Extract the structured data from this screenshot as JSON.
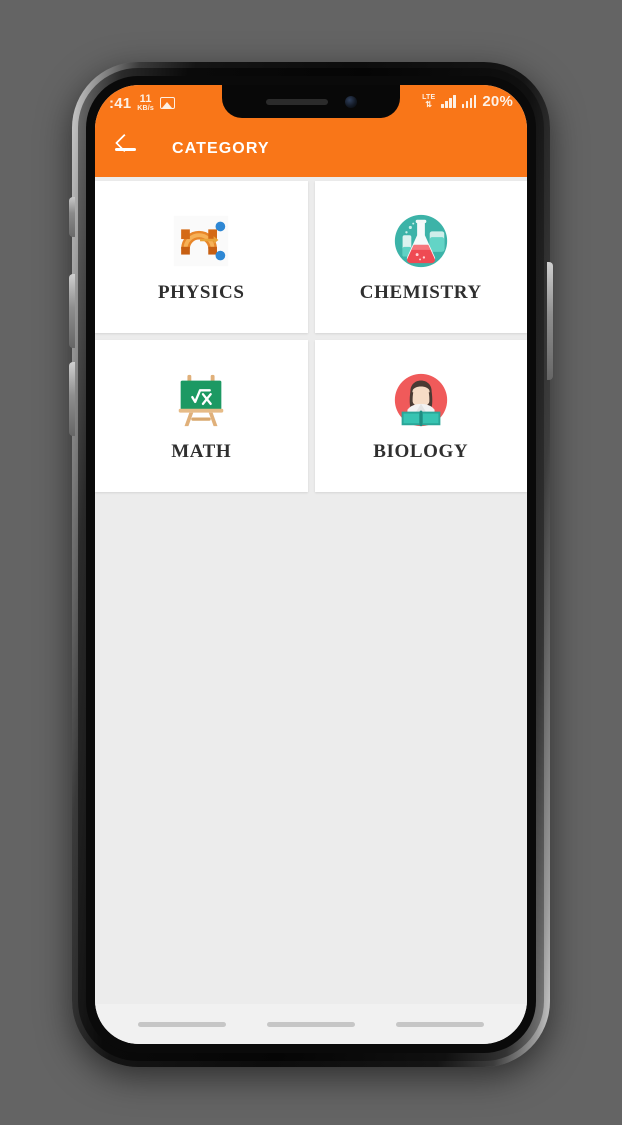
{
  "status_bar": {
    "time": ":41",
    "net_speed_value": "11",
    "net_speed_unit": "KB/s",
    "photo_icon": "image-icon",
    "network_type": "LTE",
    "data_arrows": "⇅",
    "battery": "20%"
  },
  "appbar": {
    "back_icon": "back-arrow-icon",
    "title": "CATEGORY",
    "background_color": "#f97618",
    "text_color": "#ffffff"
  },
  "categories": [
    {
      "label": "PHYSICS",
      "icon": "magnet-icon",
      "icon_color": "#f3a13a"
    },
    {
      "label": "CHEMISTRY",
      "icon": "flask-icon",
      "icon_color": "#3cb3a8"
    },
    {
      "label": "MATH",
      "icon": "chalkboard-icon",
      "icon_color": "#1c9963"
    },
    {
      "label": "BIOLOGY",
      "icon": "student-icon",
      "icon_color": "#f05a5a"
    }
  ],
  "nav_bar": {
    "items": [
      "recents-bar",
      "home-bar",
      "back-bar"
    ]
  },
  "theme": {
    "accent": "#f97618",
    "screen_background": "#ececec",
    "card_background": "#ffffff",
    "label_color": "#2f2f2f",
    "wallpaper": "#646464"
  }
}
